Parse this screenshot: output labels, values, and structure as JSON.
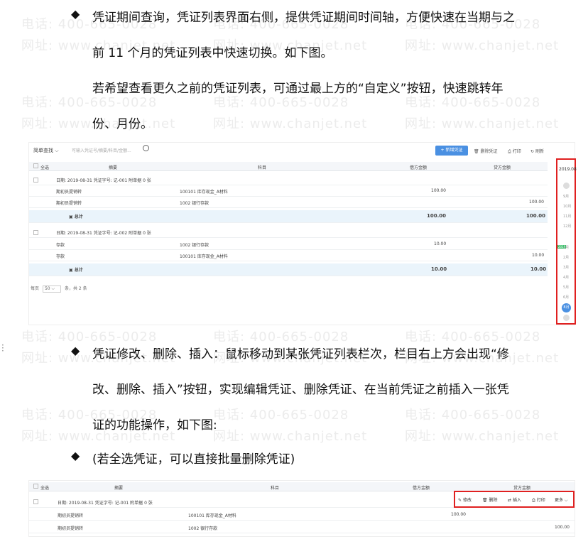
{
  "watermark": {
    "phone": "电话: 400-665-0028",
    "site": "网址: www.chanjet.net"
  },
  "bullets": {
    "b1_line1": "凭证期间查询，凭证列表界面右侧，提供凭证期间时间轴，方便快速在当期与之",
    "b1_line2": "前 11 个月的凭证列表中快速切换。如下图。",
    "b1_line3": "若希望查看更久之前的凭证列表，可通过最上方的“自定义”按钮，快速跳转年",
    "b1_line4": "份、月份。",
    "b2_line1": "凭证修改、删除、插入：鼠标移动到某张凭证列表栏次，栏目右上方会出现“修",
    "b2_line2": "改、删除、插入”按钮，实现编辑凭证、删除凭证、在当前凭证之前插入一张凭",
    "b2_line3": "证的功能操作，如下图:",
    "b3_line1": " (若全选凭证，可以直接批量删除凭证)",
    "diamond": "◆"
  },
  "shot1": {
    "filter_label": "简单查找",
    "search_placeholder": "可输入凭证号/摘要/科目/金额...",
    "btn_new": "+ 新增凭证",
    "btn_delete": "删除凭证",
    "btn_print": "打印",
    "btn_refresh": "刷新",
    "headers": [
      "全选",
      "摘要",
      "科目",
      "借方金额",
      "贷方金额"
    ],
    "voucher1_info": "日期: 2019-08-31    凭证字号: 记-001    附单据 0 张",
    "voucher1_rows": [
      {
        "summary": "期初员提销转",
        "account": "100101 库存现金_A材料",
        "debit": "100.00",
        "credit": ""
      },
      {
        "summary": "期初员提销转",
        "account": "1002 银行存款",
        "debit": "",
        "credit": "100.00"
      }
    ],
    "voucher1_total": {
      "label": "总计",
      "debit": "100.00",
      "credit": "100.00"
    },
    "voucher2_info": "日期: 2019-08-31    凭证字号: 记-002    附单据 0 张",
    "voucher2_rows": [
      {
        "summary": "存款",
        "account": "1002 银行存款",
        "debit": "10.00",
        "credit": ""
      },
      {
        "summary": "存款",
        "account": "100101 库存现金_A材料",
        "debit": "",
        "credit": "10.00"
      }
    ],
    "voucher2_total": {
      "label": "总计",
      "debit": "10.00",
      "credit": "10.00"
    },
    "pager_prefix": "每页",
    "pager_size": "50",
    "pager_suffix": "条，共 2 条",
    "timeline_year": "2019.08",
    "timeline_months": [
      "9月",
      "10月",
      "11月",
      "12月",
      "1月",
      "2月",
      "3月",
      "4月",
      "5月",
      "6月",
      "7月"
    ],
    "timeline_badge": "2019",
    "timeline_active": "8月"
  },
  "shot2": {
    "headers": [
      "全选",
      "摘要",
      "科目",
      "借方金额",
      "贷方金额"
    ],
    "voucher_info": "日期: 2019-08-31    凭证字号: 记-001    附单据 0 张",
    "rows": [
      {
        "summary": "期初员提销转",
        "account": "100101 库存现金_A材料",
        "debit": "100.00",
        "credit": ""
      },
      {
        "summary": "期初员提销转",
        "account": "1002 银行存款",
        "debit": "",
        "credit": "100.00"
      }
    ],
    "actions": [
      "修改",
      "删除",
      "插入",
      "打印",
      "更多"
    ]
  }
}
